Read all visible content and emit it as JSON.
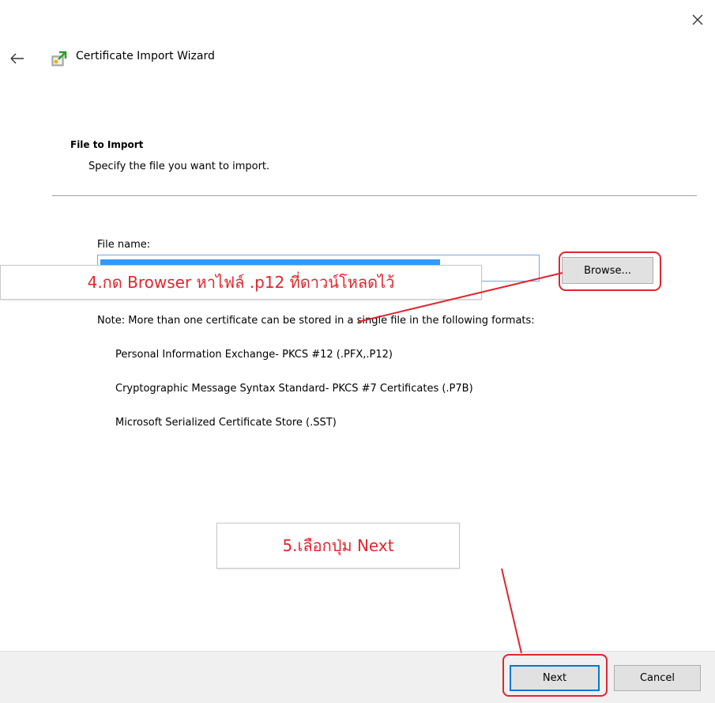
{
  "window": {
    "title": "Certificate Import Wizard",
    "close_icon": "close-icon",
    "back_icon": "back-arrow-icon",
    "app_icon": "certificate-wizard-icon"
  },
  "page": {
    "heading": "File to Import",
    "subheading": "Specify the file you want to import."
  },
  "file": {
    "label": "File name:",
    "value": "",
    "browse_label": "Browse..."
  },
  "formats": {
    "note": "Note:  More than one certificate can be stored in a single file in the following formats:",
    "items": [
      "Personal Information Exchange- PKCS #12 (.PFX,.P12)",
      "Cryptographic Message Syntax Standard- PKCS #7 Certificates (.P7B)",
      "Microsoft Serialized Certificate Store (.SST)"
    ]
  },
  "annotations": {
    "callout_browse": "4.กด Browser หาไฟล์ .p12 ที่ดาวน์โหลดไว้",
    "callout_next": "5.เลือกปุ่ม Next",
    "highlight_color": "#e0262e"
  },
  "footer": {
    "next_label": "Next",
    "cancel_label": "Cancel"
  }
}
